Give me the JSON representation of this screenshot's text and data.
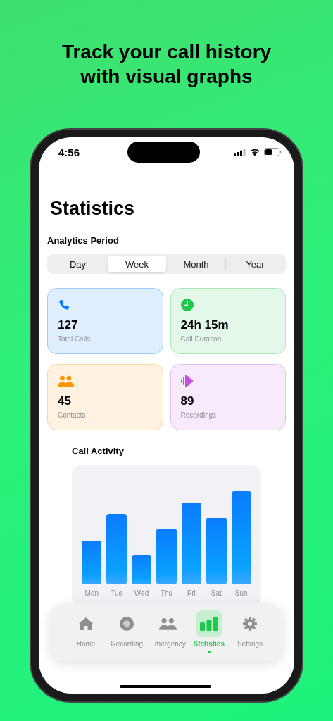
{
  "headline": [
    "Track your call history",
    "with visual graphs"
  ],
  "status_bar": {
    "time": "4:56"
  },
  "title": "Statistics",
  "period": {
    "label": "Analytics Period",
    "options": [
      {
        "label": "Day",
        "selected": false
      },
      {
        "label": "Week",
        "selected": true
      },
      {
        "label": "Month",
        "selected": false
      },
      {
        "label": "Year",
        "selected": false
      }
    ]
  },
  "stats": [
    {
      "kind": "phone",
      "value": "127",
      "label": "Total Calls",
      "color": "#007aff"
    },
    {
      "kind": "clock",
      "value": "24h 15m",
      "label": "Call Duration",
      "color": "#1ec84a"
    },
    {
      "kind": "people",
      "value": "45",
      "label": "Contacts",
      "color": "#ff9500"
    },
    {
      "kind": "wave",
      "value": "89",
      "label": "Recordings",
      "color": "#c04fe0"
    }
  ],
  "activity": {
    "title": "Call Activity",
    "days": [
      "Mon",
      "Tue",
      "Wed",
      "Thu",
      "Fri",
      "Sat",
      "Sun"
    ]
  },
  "tab_bar": [
    {
      "kind": "home",
      "label": "Home",
      "selected": false
    },
    {
      "kind": "recording",
      "label": "Recording",
      "selected": false
    },
    {
      "kind": "people",
      "label": "Emergency",
      "selected": false
    },
    {
      "kind": "chart",
      "label": "Statistics",
      "selected": true
    },
    {
      "kind": "gear",
      "label": "Settings",
      "selected": false
    }
  ]
}
